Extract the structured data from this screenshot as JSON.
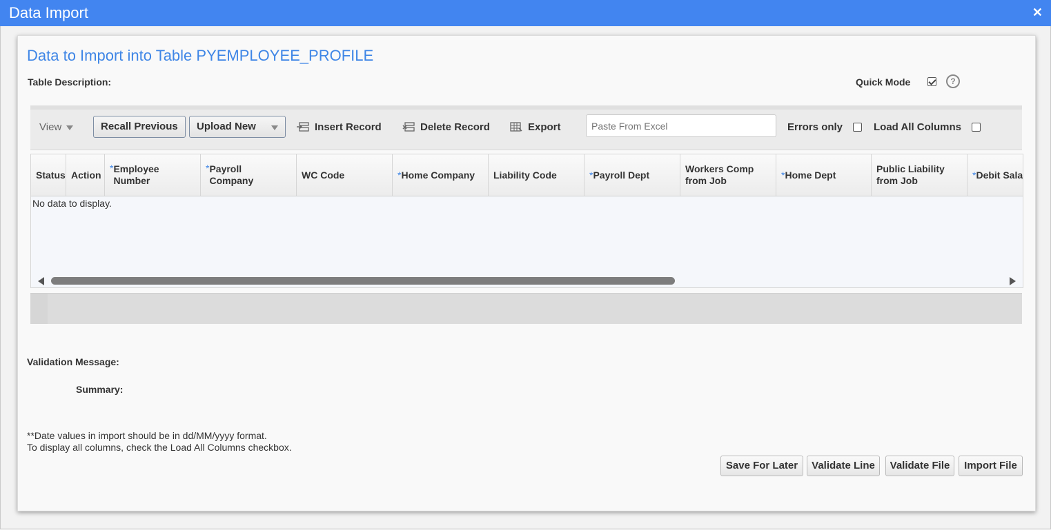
{
  "window": {
    "title": "Data Import",
    "close_glyph": "✕"
  },
  "page": {
    "heading": "Data to Import into Table PYEMPLOYEE_PROFILE",
    "table_description_label": "Table Description:",
    "quick_mode_label": "Quick Mode",
    "quick_mode_checked": true,
    "help_glyph": "?"
  },
  "toolbar": {
    "view_label": "View",
    "recall_previous": "Recall Previous",
    "upload_new": "Upload New",
    "insert_record": "Insert Record",
    "delete_record": "Delete Record",
    "export": "Export",
    "paste_placeholder": "Paste From Excel",
    "errors_only": "Errors only",
    "errors_only_checked": false,
    "load_all_columns": "Load All Columns",
    "load_all_columns_checked": false
  },
  "grid": {
    "columns": [
      {
        "required": "",
        "label": "Status"
      },
      {
        "required": "",
        "label": "Action"
      },
      {
        "required": "*",
        "label": "Employee\nNumber"
      },
      {
        "required": "*",
        "label": "Payroll\nCompany"
      },
      {
        "required": "",
        "label": "WC Code"
      },
      {
        "required": "*",
        "label": "Home Company"
      },
      {
        "required": "",
        "label": "Liability Code"
      },
      {
        "required": "*",
        "label": "Payroll Dept"
      },
      {
        "required": "",
        "label": "Workers Comp\nfrom Job"
      },
      {
        "required": "*",
        "label": "Home Dept"
      },
      {
        "required": "",
        "label": "Public Liability\nfrom Job"
      },
      {
        "required": "*",
        "label": "Debit Sala"
      }
    ],
    "empty_message": "No data to display."
  },
  "bottom": {
    "validation_message_label": "Validation Message:",
    "summary_label": "Summary:",
    "note_date_format": "**Date values in import should be in dd/MM/yyyy format.",
    "note_columns": "To display all columns, check the Load All Columns checkbox.",
    "buttons": {
      "save_for_later": "Save For Later",
      "validate_line": "Validate Line",
      "validate_file": "Validate File",
      "import_file": "Import File"
    }
  },
  "colors": {
    "titlebar": "#4285f0",
    "heading": "#3f86e6"
  }
}
